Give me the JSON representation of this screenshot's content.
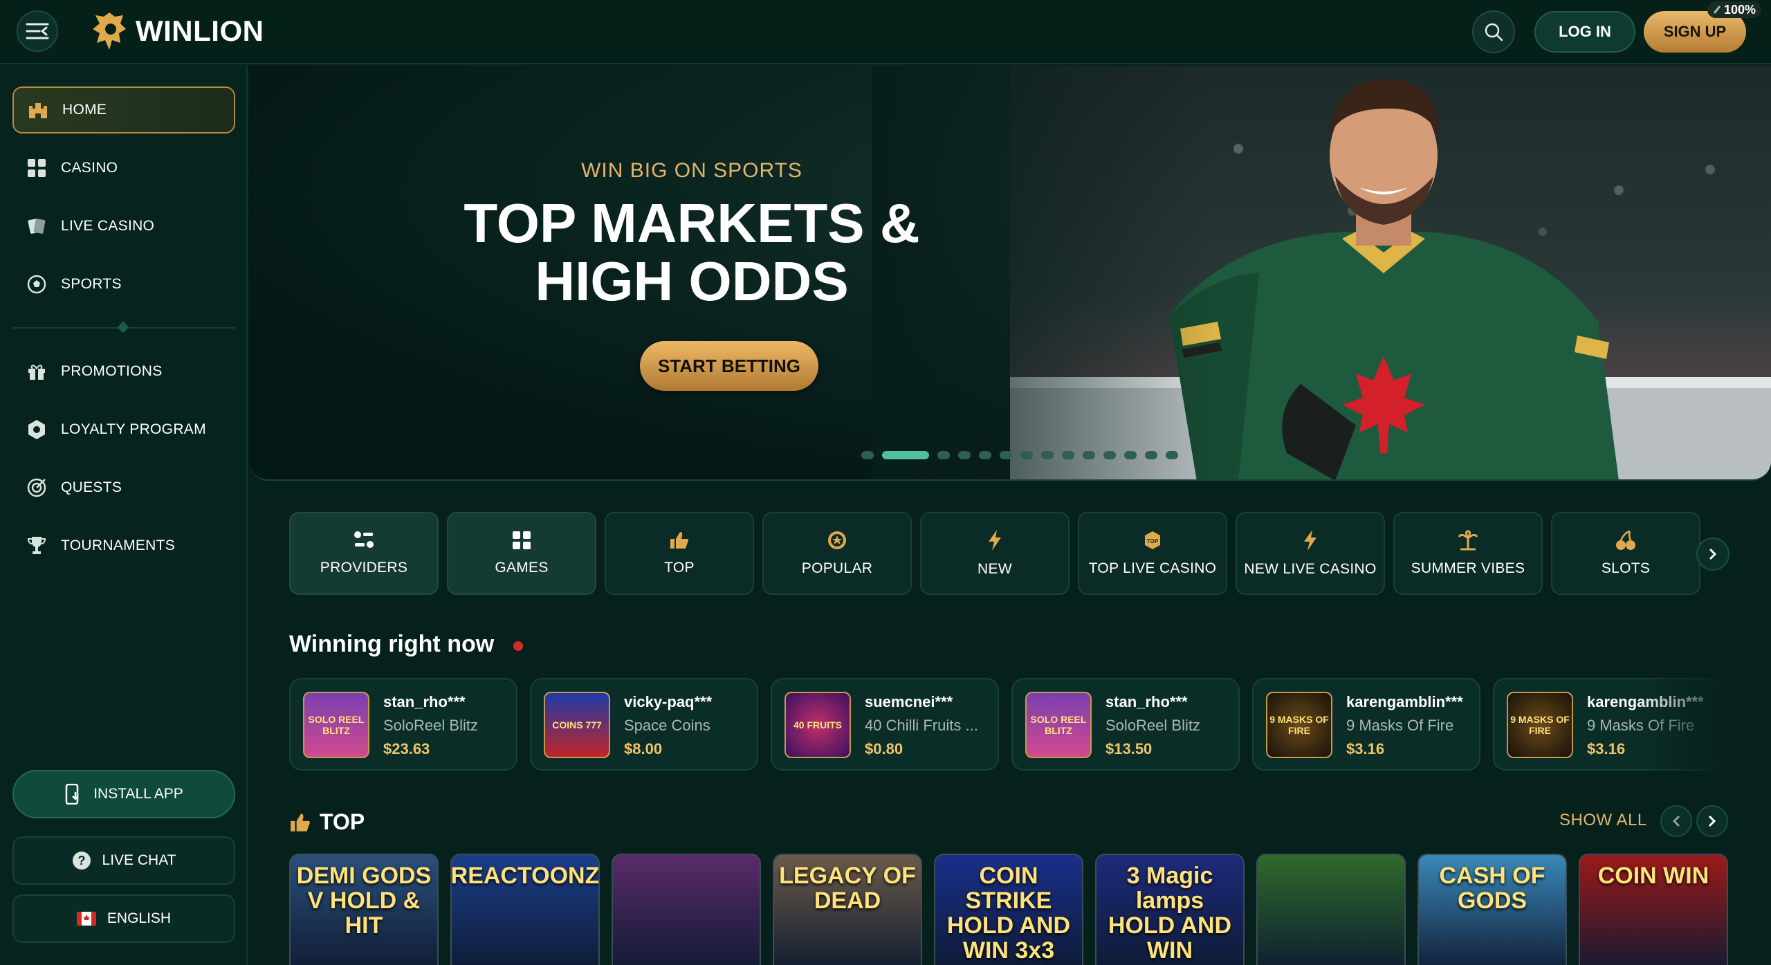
{
  "header": {
    "logo_text": "WINLION",
    "login_label": "LOG IN",
    "signup_label": "SIGN UP",
    "zoom": "100%"
  },
  "sidebar": {
    "items": [
      {
        "label": "HOME",
        "icon": "castle-icon",
        "active": true
      },
      {
        "label": "CASINO",
        "icon": "grid-icon"
      },
      {
        "label": "LIVE CASINO",
        "icon": "cards-icon"
      },
      {
        "label": "SPORTS",
        "icon": "ball-icon"
      },
      {
        "label": "PROMOTIONS",
        "icon": "gift-icon"
      },
      {
        "label": "LOYALTY PROGRAM",
        "icon": "shield-icon"
      },
      {
        "label": "QUESTS",
        "icon": "target-icon"
      },
      {
        "label": "TOURNAMENTS",
        "icon": "trophy-icon"
      }
    ],
    "install_label": "INSTALL APP",
    "live_chat_label": "LIVE CHAT",
    "language_label": "ENGLISH"
  },
  "hero": {
    "subtitle": "WIN BIG ON SPORTS",
    "title": "TOP MARKETS & HIGH ODDS",
    "cta": "START BETTING",
    "slide_count": 14,
    "active_slide": 2
  },
  "categories": [
    {
      "label": "PROVIDERS",
      "icon": "providers-icon"
    },
    {
      "label": "GAMES",
      "icon": "grid-icon"
    },
    {
      "label": "TOP",
      "icon": "thumbs-up-icon"
    },
    {
      "label": "POPULAR",
      "icon": "star-badge-icon"
    },
    {
      "label": "NEW",
      "icon": "lightning-icon"
    },
    {
      "label": "TOP LIVE CASINO",
      "icon": "crown-badge-icon"
    },
    {
      "label": "NEW LIVE CASINO",
      "icon": "lightning-icon"
    },
    {
      "label": "SUMMER VIBES",
      "icon": "palm-icon"
    },
    {
      "label": "SLOTS",
      "icon": "cherries-icon"
    }
  ],
  "winning": {
    "title": "Winning right now",
    "items": [
      {
        "user": "stan_rho***",
        "game": "SoloReel Blitz",
        "amount": "$23.63",
        "thumb": "SOLO REEL BLITZ"
      },
      {
        "user": "vicky-paq***",
        "game": "Space Coins",
        "amount": "$8.00",
        "thumb": "COINS 777"
      },
      {
        "user": "suemcnei***",
        "game": "40 Chilli Fruits ...",
        "amount": "$0.80",
        "thumb": "40 FRUITS"
      },
      {
        "user": "stan_rho***",
        "game": "SoloReel Blitz",
        "amount": "$13.50",
        "thumb": "SOLO REEL BLITZ"
      },
      {
        "user": "karengamblin***",
        "game": "9 Masks Of Fire",
        "amount": "$3.16",
        "thumb": "9 MASKS OF FIRE"
      },
      {
        "user": "karengamblin***",
        "game": "9 Masks Of Fire",
        "amount": "$3.16",
        "thumb": "9 MASKS OF FIRE"
      }
    ]
  },
  "top_section": {
    "title": "TOP",
    "show_all": "SHOW ALL",
    "games": [
      {
        "name": "DEMI GODS V HOLD & HIT",
        "bg": "#2b4f7a"
      },
      {
        "name": "REACTOONZ",
        "bg": "#1b3e8a"
      },
      {
        "name": "",
        "bg": "#5a2a6a"
      },
      {
        "name": "LEGACY OF DEAD",
        "bg": "#6a5a4a"
      },
      {
        "name": "COIN STRIKE HOLD AND WIN 3x3",
        "bg": "#1a2f8a"
      },
      {
        "name": "3 Magic lamps HOLD AND WIN",
        "bg": "#1d2a7a"
      },
      {
        "name": "",
        "bg": "#2f6a2a"
      },
      {
        "name": "CASH OF GODS",
        "bg": "#3a88b8"
      },
      {
        "name": "COIN WIN",
        "bg": "#9a1a1a"
      }
    ]
  }
}
